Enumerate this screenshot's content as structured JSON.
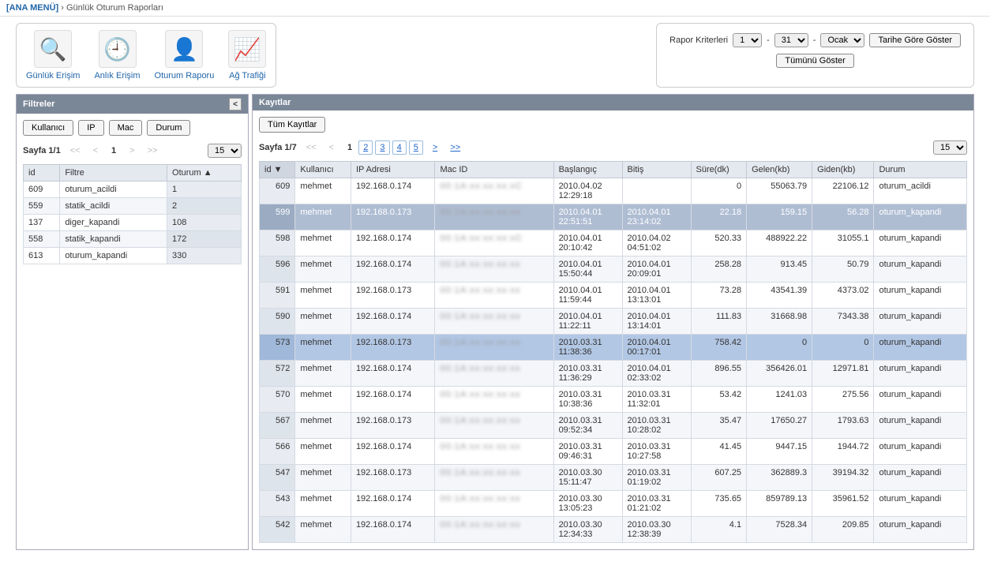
{
  "breadcrumb": {
    "home": "[ANA MENÜ]",
    "sep": "›",
    "current": "Günlük Oturum Raporları"
  },
  "toolbar": {
    "items": [
      {
        "icon": "🔍",
        "label": "Günlük Erişim"
      },
      {
        "icon": "🕘",
        "label": "Anlık Erişim"
      },
      {
        "icon": "👤",
        "label": "Oturum Raporu"
      },
      {
        "icon": "📈",
        "label": "Ağ Trafiği"
      }
    ]
  },
  "criteria": {
    "label": "Rapor Kriterleri",
    "day_from": "1",
    "day_to": "31",
    "month": "Ocak",
    "show_by_date": "Tarihe Göre Göster",
    "show_all": "Tümünü Göster",
    "sep": "-"
  },
  "filters": {
    "title": "Filtreler",
    "tabs": [
      "Kullanıcı",
      "IP",
      "Mac",
      "Durum"
    ],
    "pager_label": "Sayfa 1/1",
    "pager_current": "1",
    "per_page": "15",
    "headers": [
      "id",
      "Filtre",
      "Oturum ▲"
    ],
    "rows": [
      {
        "id": "609",
        "filter": "oturum_acildi",
        "count": "1"
      },
      {
        "id": "559",
        "filter": "statik_acildi",
        "count": "2"
      },
      {
        "id": "137",
        "filter": "diger_kapandi",
        "count": "108"
      },
      {
        "id": "558",
        "filter": "statik_kapandi",
        "count": "172"
      },
      {
        "id": "613",
        "filter": "oturum_kapandi",
        "count": "330"
      }
    ]
  },
  "records": {
    "title": "Kayıtlar",
    "all_btn": "Tüm Kayıtlar",
    "pager_label": "Sayfa 1/7",
    "pages": [
      "1",
      "2",
      "3",
      "4",
      "5"
    ],
    "per_page": "15",
    "headers": [
      "id ▼",
      "Kullanıcı",
      "IP Adresi",
      "Mac ID",
      "Başlangıç",
      "Bitiş",
      "Süre(dk)",
      "Gelen(kb)",
      "Giden(kb)",
      "Durum"
    ],
    "rows": [
      {
        "id": "609",
        "user": "mehmet",
        "ip": "192.168.0.174",
        "mac": "00:1A:xx:xx:xx:xC",
        "start": "2010.04.02 12:29:18",
        "end": "",
        "dur": "0",
        "in": "55063.79",
        "out": "22106.12",
        "status": "oturum_acildi",
        "cls": ""
      },
      {
        "id": "599",
        "user": "mehmet",
        "ip": "192.168.0.173",
        "mac": "00:1A:xx:xx:xx:xx",
        "start": "2010.04.01 22:51:51",
        "end": "2010.04.01 23:14:02",
        "dur": "22.18",
        "in": "159.15",
        "out": "56.28",
        "status": "oturum_kapandi",
        "cls": "hl"
      },
      {
        "id": "598",
        "user": "mehmet",
        "ip": "192.168.0.174",
        "mac": "00:1A:xx:xx:xx:xC",
        "start": "2010.04.01 20:10:42",
        "end": "2010.04.02 04:51:02",
        "dur": "520.33",
        "in": "488922.22",
        "out": "31055.1",
        "status": "oturum_kapandi",
        "cls": ""
      },
      {
        "id": "596",
        "user": "mehmet",
        "ip": "192.168.0.174",
        "mac": "00:1A:xx:xx:xx:xx",
        "start": "2010.04.01 15:50:44",
        "end": "2010.04.01 20:09:01",
        "dur": "258.28",
        "in": "913.45",
        "out": "50.79",
        "status": "oturum_kapandi",
        "cls": ""
      },
      {
        "id": "591",
        "user": "mehmet",
        "ip": "192.168.0.173",
        "mac": "00:1A:xx:xx:xx:xx",
        "start": "2010.04.01 11:59:44",
        "end": "2010.04.01 13:13:01",
        "dur": "73.28",
        "in": "43541.39",
        "out": "4373.02",
        "status": "oturum_kapandi",
        "cls": ""
      },
      {
        "id": "590",
        "user": "mehmet",
        "ip": "192.168.0.174",
        "mac": "00:1A:xx:xx:xx:xx",
        "start": "2010.04.01 11:22:11",
        "end": "2010.04.01 13:14:01",
        "dur": "111.83",
        "in": "31668.98",
        "out": "7343.38",
        "status": "oturum_kapandi",
        "cls": ""
      },
      {
        "id": "573",
        "user": "mehmet",
        "ip": "192.168.0.173",
        "mac": "00:1A:xx:xx:xx:xx",
        "start": "2010.03.31 11:38:36",
        "end": "2010.04.01 00:17:01",
        "dur": "758.42",
        "in": "0",
        "out": "0",
        "status": "oturum_kapandi",
        "cls": "hl2"
      },
      {
        "id": "572",
        "user": "mehmet",
        "ip": "192.168.0.174",
        "mac": "00:1A:xx:xx:xx:xx",
        "start": "2010.03.31 11:36:29",
        "end": "2010.04.01 02:33:02",
        "dur": "896.55",
        "in": "356426.01",
        "out": "12971.81",
        "status": "oturum_kapandi",
        "cls": ""
      },
      {
        "id": "570",
        "user": "mehmet",
        "ip": "192.168.0.174",
        "mac": "00:1A:xx:xx:xx:xx",
        "start": "2010.03.31 10:38:36",
        "end": "2010.03.31 11:32:01",
        "dur": "53.42",
        "in": "1241.03",
        "out": "275.56",
        "status": "oturum_kapandi",
        "cls": ""
      },
      {
        "id": "567",
        "user": "mehmet",
        "ip": "192.168.0.173",
        "mac": "00:1A:xx:xx:xx:xx",
        "start": "2010.03.31 09:52:34",
        "end": "2010.03.31 10:28:02",
        "dur": "35.47",
        "in": "17650.27",
        "out": "1793.63",
        "status": "oturum_kapandi",
        "cls": ""
      },
      {
        "id": "566",
        "user": "mehmet",
        "ip": "192.168.0.174",
        "mac": "00:1A:xx:xx:xx:xx",
        "start": "2010.03.31 09:46:31",
        "end": "2010.03.31 10:27:58",
        "dur": "41.45",
        "in": "9447.15",
        "out": "1944.72",
        "status": "oturum_kapandi",
        "cls": ""
      },
      {
        "id": "547",
        "user": "mehmet",
        "ip": "192.168.0.173",
        "mac": "00:1A:xx:xx:xx:xx",
        "start": "2010.03.30 15:11:47",
        "end": "2010.03.31 01:19:02",
        "dur": "607.25",
        "in": "362889.3",
        "out": "39194.32",
        "status": "oturum_kapandi",
        "cls": ""
      },
      {
        "id": "543",
        "user": "mehmet",
        "ip": "192.168.0.174",
        "mac": "00:1A:xx:xx:xx:xx",
        "start": "2010.03.30 13:05:23",
        "end": "2010.03.31 01:21:02",
        "dur": "735.65",
        "in": "859789.13",
        "out": "35961.52",
        "status": "oturum_kapandi",
        "cls": ""
      },
      {
        "id": "542",
        "user": "mehmet",
        "ip": "192.168.0.174",
        "mac": "00:1A:xx:xx:xx:xx",
        "start": "2010.03.30 12:34:33",
        "end": "2010.03.30 12:38:39",
        "dur": "4.1",
        "in": "7528.34",
        "out": "209.85",
        "status": "oturum_kapandi",
        "cls": ""
      }
    ]
  }
}
